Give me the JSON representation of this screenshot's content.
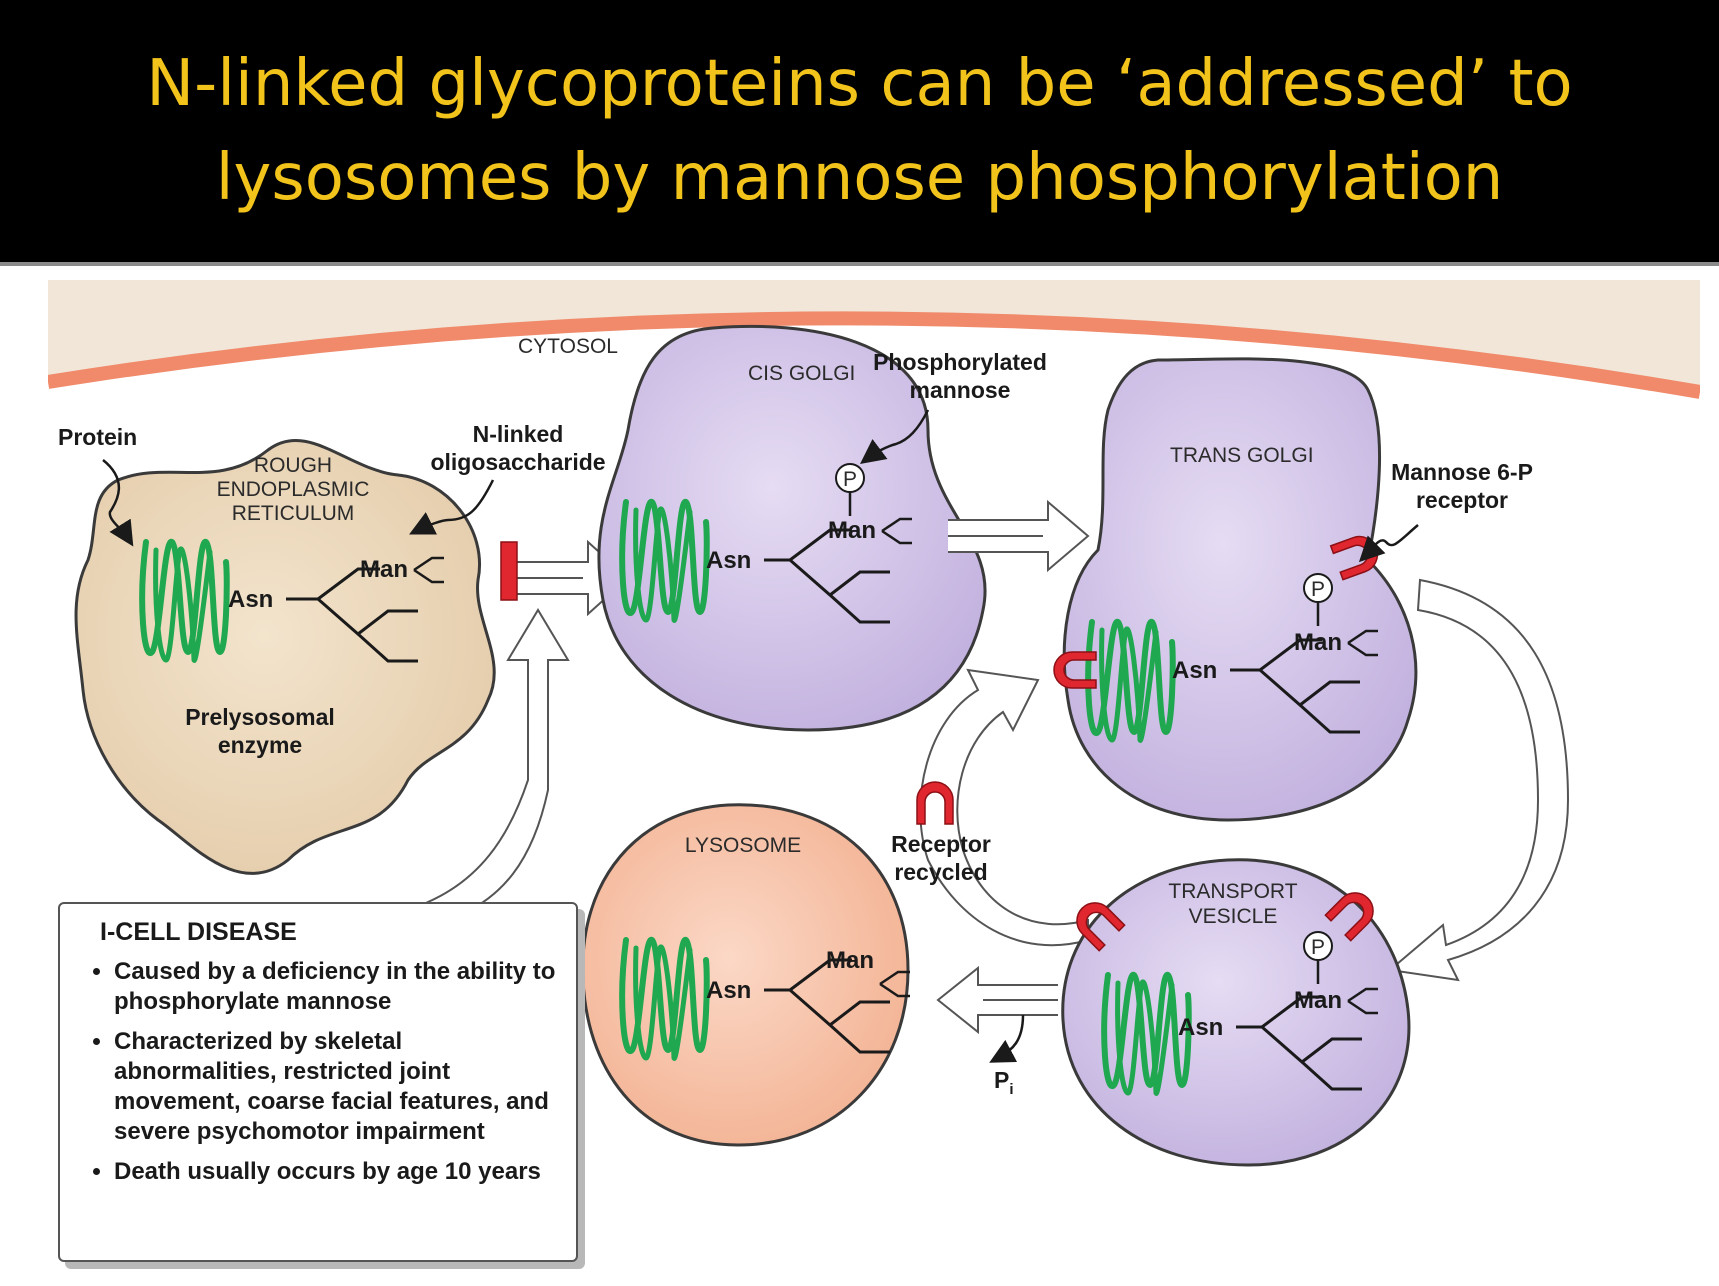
{
  "slide": {
    "title_line_1": "N-linked glycoproteins can be ‘addressed’ to",
    "title_line_2": "lysosomes by mannose phosphorylation"
  },
  "diagram": {
    "cytosol": "CYTOSOL",
    "protein": "Protein",
    "rer": [
      "ROUGH",
      "ENDOPLASMIC",
      "RETICULUM"
    ],
    "n_linked": [
      "N-linked",
      "oligosaccharide"
    ],
    "prelysosomal": [
      "Prelysosomal",
      "enzyme"
    ],
    "cis_golgi": "CIS GOLGI",
    "phosphorylated_mannose": [
      "Phosphorylated",
      "mannose"
    ],
    "trans_golgi": "TRANS GOLGI",
    "m6p_receptor": [
      "Mannose 6-P",
      "receptor"
    ],
    "receptor_recycled": [
      "Receptor",
      "recycled"
    ],
    "lysosome": "LYSOSOME",
    "transport_vesicle": [
      "TRANSPORT",
      "VESICLE"
    ],
    "phosphate_released": "P",
    "phosphate_subscript": "i",
    "asn": "Asn",
    "man": "Man",
    "p": "P"
  },
  "i_cell_box": {
    "title": "I-CELL DISEASE",
    "bullets": [
      "Caused by a deficiency in the ability to phosphorylate mannose",
      "Characterized by skeletal abnormalities, restricted joint movement, coarse facial features, and severe psychomotor impairment",
      "Death usually occurs by age 10 years"
    ]
  },
  "colors": {
    "title_text": "#f2c31a",
    "title_bar": "#000000",
    "cytosol_band": "#f1e6d8",
    "membrane_edge": "#f08a6a",
    "rer_fill": "#ecd6b8",
    "golgi_fill": "#cfc1e6",
    "lysosome_fill": "#f6c2a8",
    "protein_green": "#1fa84f",
    "receptor_red": "#e0262e"
  }
}
